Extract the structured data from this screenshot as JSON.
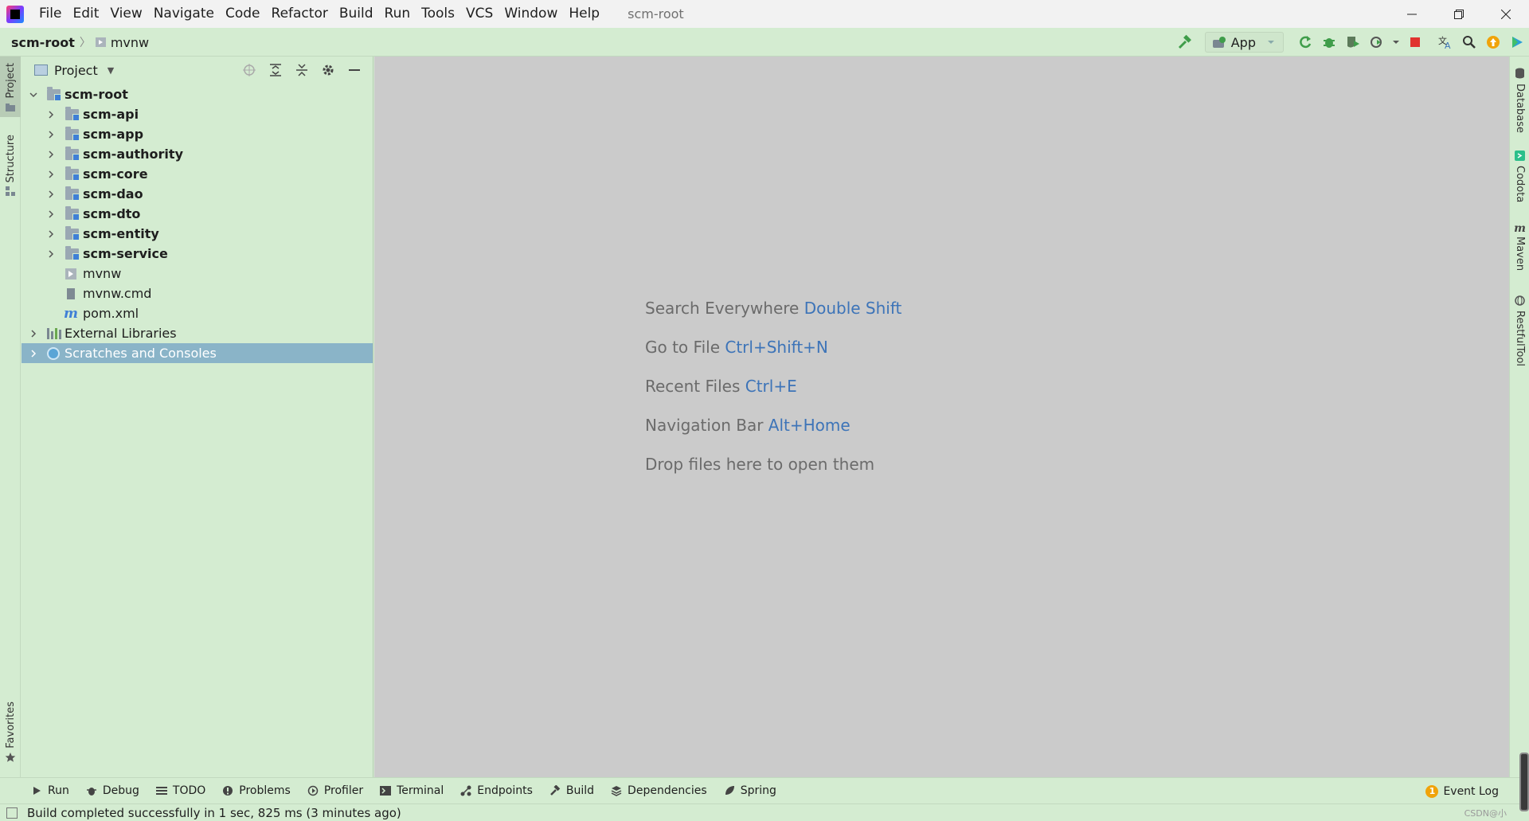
{
  "menubar": {
    "items": [
      "File",
      "Edit",
      "View",
      "Navigate",
      "Code",
      "Refactor",
      "Build",
      "Run",
      "Tools",
      "VCS",
      "Window",
      "Help"
    ],
    "window_title": "scm-root"
  },
  "navbar": {
    "breadcrumb_root": "scm-root",
    "breadcrumb_separator": "〉",
    "breadcrumb_file": "mvnw",
    "run_config": "App"
  },
  "left_strip": {
    "project": "Project",
    "structure": "Structure",
    "favorites": "Favorites"
  },
  "project_panel": {
    "title": "Project",
    "tree": [
      {
        "label": "scm-root",
        "depth": 0,
        "expanded": true,
        "icon": "folder-module",
        "bold": true
      },
      {
        "label": "scm-api",
        "depth": 1,
        "expanded": false,
        "icon": "folder-module",
        "bold": true
      },
      {
        "label": "scm-app",
        "depth": 1,
        "expanded": false,
        "icon": "folder-module",
        "bold": true
      },
      {
        "label": "scm-authority",
        "depth": 1,
        "expanded": false,
        "icon": "folder-module",
        "bold": true
      },
      {
        "label": "scm-core",
        "depth": 1,
        "expanded": false,
        "icon": "folder-module",
        "bold": true
      },
      {
        "label": "scm-dao",
        "depth": 1,
        "expanded": false,
        "icon": "folder-module",
        "bold": true
      },
      {
        "label": "scm-dto",
        "depth": 1,
        "expanded": false,
        "icon": "folder-module",
        "bold": true
      },
      {
        "label": "scm-entity",
        "depth": 1,
        "expanded": false,
        "icon": "folder-module",
        "bold": true
      },
      {
        "label": "scm-service",
        "depth": 1,
        "expanded": false,
        "icon": "folder-module",
        "bold": true
      },
      {
        "label": "mvnw",
        "depth": 1,
        "icon": "terminal-file",
        "bold": false
      },
      {
        "label": "mvnw.cmd",
        "depth": 1,
        "icon": "cmd-file",
        "bold": false
      },
      {
        "label": "pom.xml",
        "depth": 1,
        "icon": "maven-file",
        "bold": false
      },
      {
        "label": "External Libraries",
        "depth": 0,
        "expanded": false,
        "icon": "library",
        "bold": false
      },
      {
        "label": "Scratches and Consoles",
        "depth": 0,
        "expanded": false,
        "icon": "scratch",
        "bold": false,
        "selected": true
      }
    ]
  },
  "editor": {
    "hints": [
      {
        "text": "Search Everywhere",
        "key": "Double Shift"
      },
      {
        "text": "Go to File",
        "key": "Ctrl+Shift+N"
      },
      {
        "text": "Recent Files",
        "key": "Ctrl+E"
      },
      {
        "text": "Navigation Bar",
        "key": "Alt+Home"
      },
      {
        "text": "Drop files here to open them",
        "key": ""
      }
    ]
  },
  "right_strip": {
    "database": "Database",
    "codota": "Codota",
    "maven": "Maven",
    "restful": "RestfulTool"
  },
  "bottom_bar": {
    "items": [
      "Run",
      "Debug",
      "TODO",
      "Problems",
      "Profiler",
      "Terminal",
      "Endpoints",
      "Build",
      "Dependencies",
      "Spring"
    ],
    "event_log": "Event Log",
    "event_count": "1"
  },
  "status_bar": {
    "text": "Build completed successfully in 1 sec, 825 ms (3 minutes ago)",
    "watermark": "CSDN@小"
  },
  "colors": {
    "panel_bg": "#d4ecd1",
    "editor_bg": "#cbcbcb",
    "selection": "#8ab4c8",
    "hint_key": "#3d74b8",
    "stop_red": "#e0332f",
    "build_green": "#3f9d4a"
  }
}
